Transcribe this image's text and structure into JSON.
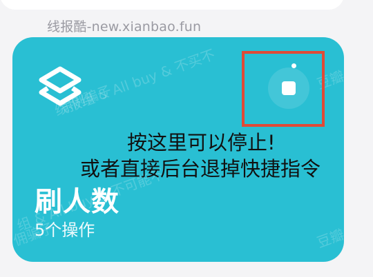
{
  "watermark": {
    "top_text": "线报酷-new.xianbao.fun",
    "card_texts": [
      "线报组 & All buy & 不买不",
      "涂俐骗子",
      "豆瓣",
      "豆瓣",
      "组 & All buy & 不可能不",
      "佣骗子"
    ]
  },
  "shortcut": {
    "name": "刷人数",
    "subtitle": "5个操作",
    "icon": "shortcuts-app-icon",
    "stop_icon": "stop-square-icon",
    "card_color": "#29bfd3"
  },
  "annotation": {
    "line1": "按这里可以停止!",
    "line2": "或者直接后台退掉快捷指令",
    "highlight_color": "#e04a36"
  }
}
